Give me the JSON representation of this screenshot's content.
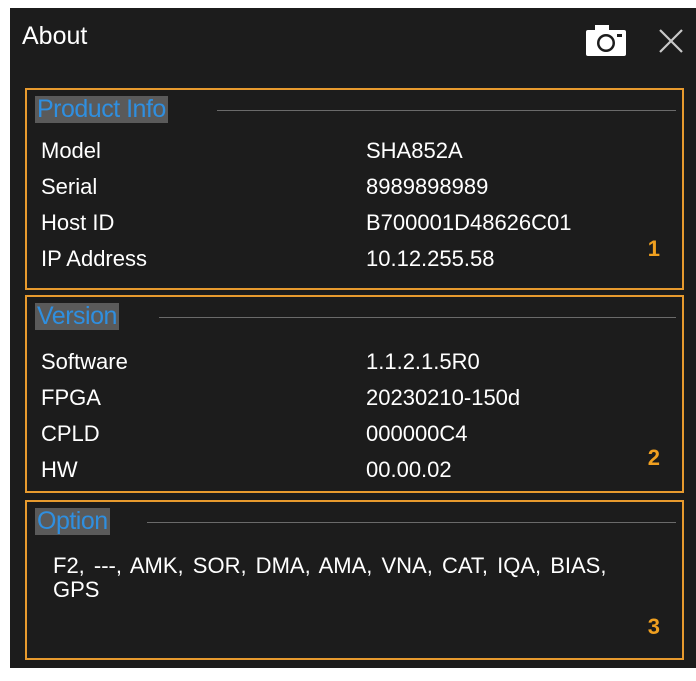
{
  "dialog": {
    "title": "About"
  },
  "product_info": {
    "heading": "Product Info",
    "rows": [
      {
        "label": "Model",
        "value": "SHA852A"
      },
      {
        "label": "Serial",
        "value": "8989898989"
      },
      {
        "label": "Host ID",
        "value": "B700001D48626C01"
      },
      {
        "label": "IP Address",
        "value": "10.12.255.58"
      }
    ],
    "marker": "1"
  },
  "version": {
    "heading": "Version",
    "rows": [
      {
        "label": "Software",
        "value": "1.1.2.1.5R0"
      },
      {
        "label": "FPGA",
        "value": "20230210-150d"
      },
      {
        "label": "CPLD",
        "value": "000000C4"
      },
      {
        "label": "HW",
        "value": "00.00.02"
      }
    ],
    "marker": "2"
  },
  "option": {
    "heading": "Option",
    "text": "F2,  ---,  AMK,  SOR,  DMA,  AMA,  VNA,  CAT,  IQA,  BIAS,  GPS",
    "marker": "3"
  },
  "icons": {
    "screenshot": "camera-icon",
    "close": "close-icon"
  },
  "colors": {
    "background": "#1c1c1c",
    "border_accent": "#e79a2e",
    "heading_text": "#2f8fe0",
    "heading_bg": "#5a5a5a",
    "marker": "#f0a020"
  }
}
